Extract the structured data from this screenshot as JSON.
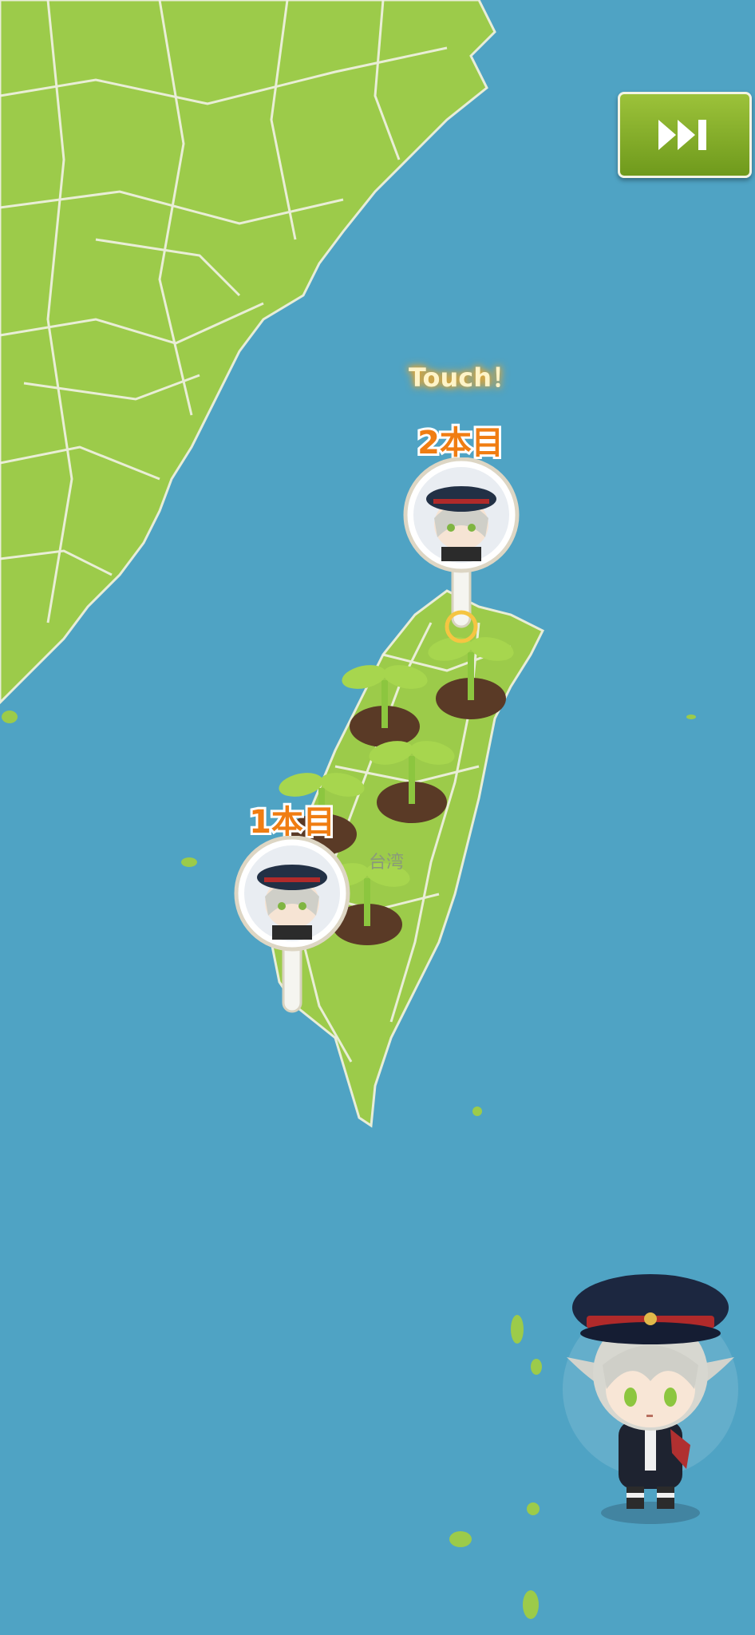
{
  "hud": {
    "skip_icon": "fast-forward-icon",
    "skip_color": "#86b02a",
    "touch_prompt": "Touch！"
  },
  "map": {
    "sea_color": "#4fa3c4",
    "land_color": "#9ccb4a",
    "road_color": "#f2f2e6",
    "place_label": "台湾"
  },
  "pins": [
    {
      "label": "1本目",
      "icon": "character-portrait-icon"
    },
    {
      "label": "2本目",
      "icon": "character-portrait-icon"
    }
  ],
  "sprouts": {
    "count": 5,
    "icon": "sprout-icon"
  },
  "character": {
    "icon": "chibi-character-icon"
  }
}
